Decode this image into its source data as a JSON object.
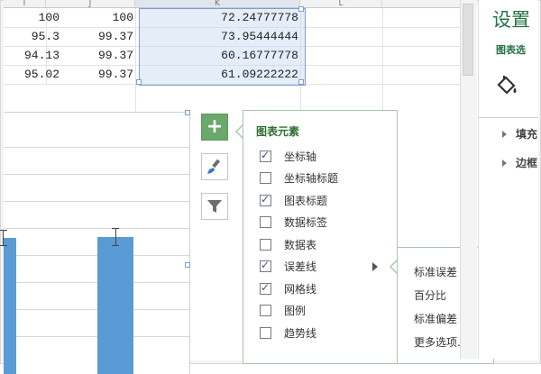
{
  "sheet": {
    "col_headers": [
      "I",
      "J",
      "K",
      "L"
    ],
    "rows": [
      {
        "i": "100",
        "j": "100",
        "k": "72.24777778"
      },
      {
        "i": "95.3",
        "j": "99.37",
        "k": "73.95444444"
      },
      {
        "i": "94.13",
        "j": "99.37",
        "k": "60.16777778"
      },
      {
        "i": "95.02",
        "j": "99.37",
        "k": "61.09222222"
      }
    ]
  },
  "chart_elements_panel": {
    "title": "图表元素",
    "options": [
      {
        "label": "坐标轴",
        "checked": true
      },
      {
        "label": "坐标轴标题",
        "checked": false
      },
      {
        "label": "图表标题",
        "checked": true
      },
      {
        "label": "数据标签",
        "checked": false
      },
      {
        "label": "数据表",
        "checked": false
      },
      {
        "label": "误差线",
        "checked": true
      },
      {
        "label": "网格线",
        "checked": true
      },
      {
        "label": "图例",
        "checked": false
      },
      {
        "label": "趋势线",
        "checked": false
      }
    ]
  },
  "error_bar_submenu": {
    "items": [
      "标准误差",
      "百分比",
      "标准偏差",
      "更多选项..."
    ]
  },
  "chart_buttons": {
    "plus": "+",
    "style_icon": "brush-icon",
    "filter_icon": "filter-icon"
  },
  "format_pane": {
    "title": "设置",
    "subtitle": "图表选",
    "icon": "paint-bucket-icon",
    "sections": [
      "填充",
      "边框"
    ]
  },
  "colors": {
    "bar": "#5b9bd5",
    "accent": "#217346",
    "panel_border": "#a9c6a9",
    "check": "#2c5aa0"
  }
}
